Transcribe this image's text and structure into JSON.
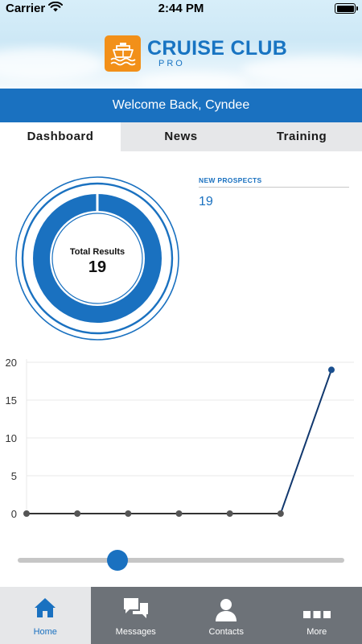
{
  "status_bar": {
    "carrier": "Carrier",
    "time": "2:44 PM",
    "wifi_icon": "wifi-icon",
    "battery_icon": "battery-icon"
  },
  "header": {
    "logo_icon": "cruise-ship-icon",
    "logo_title": "CRUISE CLUB",
    "logo_subtitle": "PRO",
    "welcome_text": "Welcome Back, Cyndee"
  },
  "tabs": [
    {
      "label": "Dashboard",
      "active": true
    },
    {
      "label": "News",
      "active": false
    },
    {
      "label": "Training",
      "active": false
    }
  ],
  "summary": {
    "total_label": "Total Results",
    "total_value": "19",
    "prospects_label": "NEW PROSPECTS",
    "prospects_value": "19"
  },
  "chart_data": {
    "type": "line",
    "title": "",
    "xlabel": "",
    "ylabel": "",
    "x": [
      1,
      2,
      3,
      4,
      5,
      6,
      7
    ],
    "series": [
      {
        "values": [
          0,
          0,
          0,
          0,
          0,
          0,
          19
        ]
      }
    ],
    "ylim": [
      0,
      20
    ],
    "yticks": [
      0,
      5,
      10,
      15,
      20
    ],
    "grid": true,
    "colors": {
      "line": "#11386e",
      "baseline": "#333333",
      "points": "#555555",
      "last_point": "#1a4f8f",
      "grid": "#e8e8e8"
    }
  },
  "slider": {
    "value": 0.3
  },
  "bottom_nav": [
    {
      "label": "Home",
      "icon": "home-icon",
      "active": true
    },
    {
      "label": "Messages",
      "icon": "messages-icon",
      "active": false
    },
    {
      "label": "Contacts",
      "icon": "contacts-icon",
      "active": false
    },
    {
      "label": "More",
      "icon": "more-icon",
      "active": false
    }
  ],
  "colors": {
    "brand_blue": "#1a71c0",
    "logo_orange": "#f29019",
    "nav_bg": "#6d7278",
    "tab_bg": "#e6e7e9"
  }
}
